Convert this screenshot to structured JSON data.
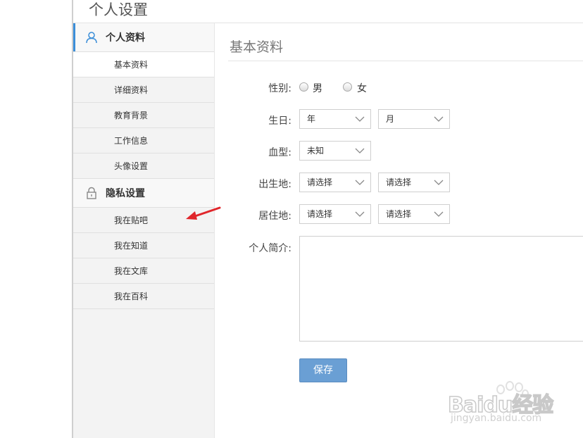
{
  "page": {
    "title": "个人设置"
  },
  "sidebar": {
    "sections": [
      {
        "label": "个人资料",
        "icon": "user-icon",
        "items": [
          "基本资料",
          "详细资料",
          "教育背景",
          "工作信息",
          "头像设置"
        ]
      },
      {
        "label": "隐私设置",
        "icon": "lock-icon",
        "items": [
          "我在贴吧",
          "我在知道",
          "我在文库",
          "我在百科"
        ]
      }
    ]
  },
  "content": {
    "title": "基本资料",
    "gender": {
      "label": "性别:",
      "options": [
        "男",
        "女"
      ]
    },
    "birthday": {
      "label": "生日:",
      "year": "年",
      "month": "月"
    },
    "blood_type": {
      "label": "血型:",
      "value": "未知"
    },
    "birthplace": {
      "label": "出生地:",
      "province": "请选择",
      "city": "请选择"
    },
    "residence": {
      "label": "居住地:",
      "province": "请选择",
      "city": "请选择"
    },
    "bio": {
      "label": "个人简介:"
    },
    "save_label": "保存"
  },
  "watermark": {
    "text": "Baidu经验",
    "sub": "jingyan.baidu.com"
  },
  "colors": {
    "accent": "#3b8ed8",
    "button": "#6a9fd4",
    "arrow": "#e0262b"
  }
}
